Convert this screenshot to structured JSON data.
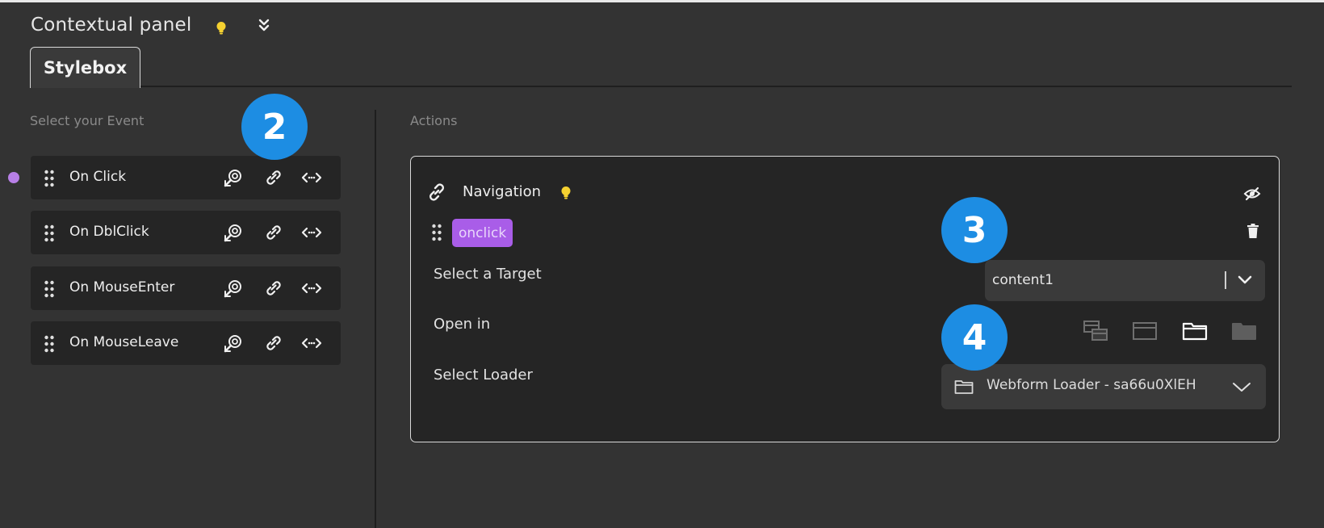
{
  "panel": {
    "title": "Contextual panel"
  },
  "tabs": [
    {
      "label": "Stylebox",
      "active": true
    }
  ],
  "events": {
    "section_label": "Select your Event",
    "items": [
      {
        "label": "On Click",
        "active": true
      },
      {
        "label": "On DblClick",
        "active": false
      },
      {
        "label": "On MouseEnter",
        "active": false
      },
      {
        "label": "On MouseLeave",
        "active": false
      }
    ],
    "row_icons": [
      "magic-select-icon",
      "link-icon",
      "code-arrows-icon"
    ]
  },
  "actions": {
    "section_label": "Actions",
    "card": {
      "title": "Navigation",
      "event_tag": "onclick",
      "target_label": "Select a Target",
      "target_value": "content1",
      "open_in_label": "Open in",
      "open_in_options": [
        "popup-icon",
        "frame-icon",
        "folder-icon",
        "folder-filled-icon"
      ],
      "open_in_selected": "folder-icon",
      "loader_label": "Select Loader",
      "loader_value": "Webform Loader - sa66u0XlEH"
    }
  },
  "badges": [
    "2",
    "3",
    "4"
  ],
  "colors": {
    "background": "#333333",
    "card": "#252525",
    "accent_purple": "#a95de8",
    "badge_blue": "#1d8de3",
    "bulb_yellow": "#f5d130"
  }
}
